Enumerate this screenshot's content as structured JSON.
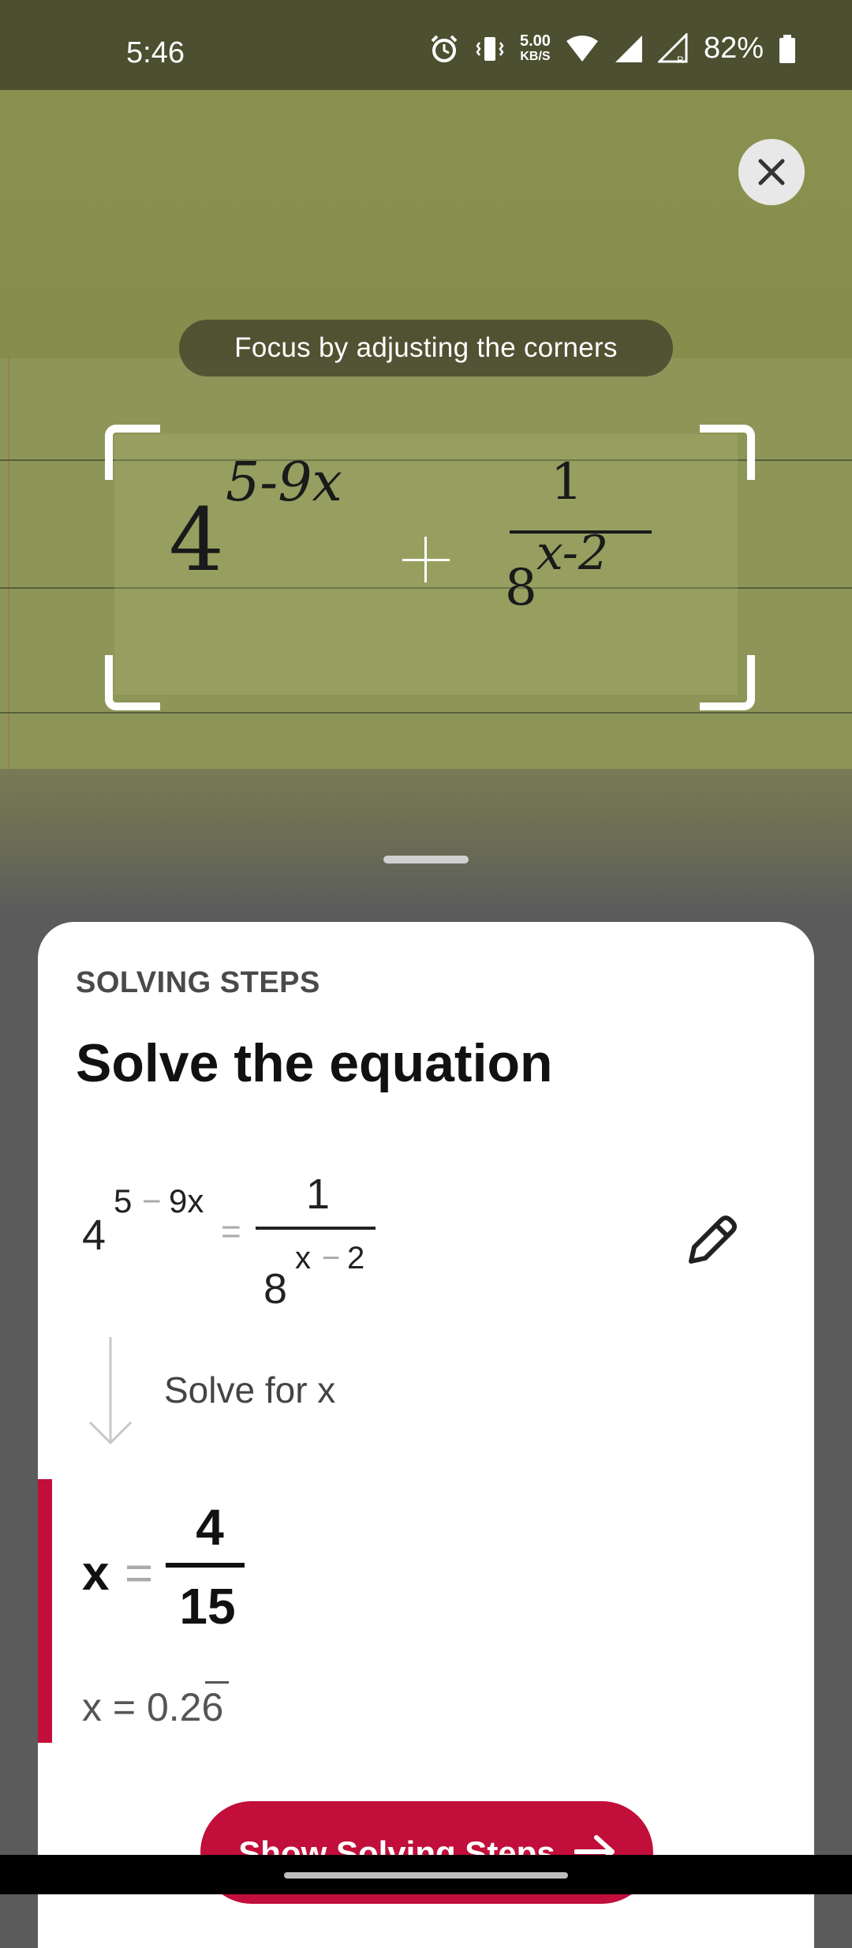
{
  "status_bar": {
    "time": "5:46",
    "net_speed_value": "5.00",
    "net_speed_unit": "KB/S",
    "battery": "82%",
    "icons": [
      "alarm-icon",
      "vibrate-icon",
      "wifi-icon",
      "signal-icon",
      "signal-roaming-icon",
      "battery-icon"
    ]
  },
  "camera": {
    "focus_hint": "Focus by adjusting the corners",
    "close_icon": "close-icon",
    "handwritten": {
      "base": "4",
      "exponent": "5-9x",
      "equals": "=",
      "numerator": "1",
      "denominator_base": "8",
      "denominator_exponent": "x-2"
    }
  },
  "sheet": {
    "section_label": "SOLVING STEPS",
    "title": "Solve the equation",
    "equation": {
      "base": "4",
      "exponent_a": "5",
      "exponent_op": "−",
      "exponent_b": "9x",
      "equals": "=",
      "numerator": "1",
      "denominator_base": "8",
      "denominator_exp_a": "x",
      "denominator_exp_op": "−",
      "denominator_exp_b": "2"
    },
    "step_label": "Solve for x",
    "result": {
      "variable": "x",
      "equals": "=",
      "numerator": "4",
      "denominator": "15",
      "decimal_prefix": "x = 0.2",
      "decimal_repeat": "6"
    },
    "cta_label": "Show Solving Steps",
    "accent_color": "#c10e3a"
  }
}
